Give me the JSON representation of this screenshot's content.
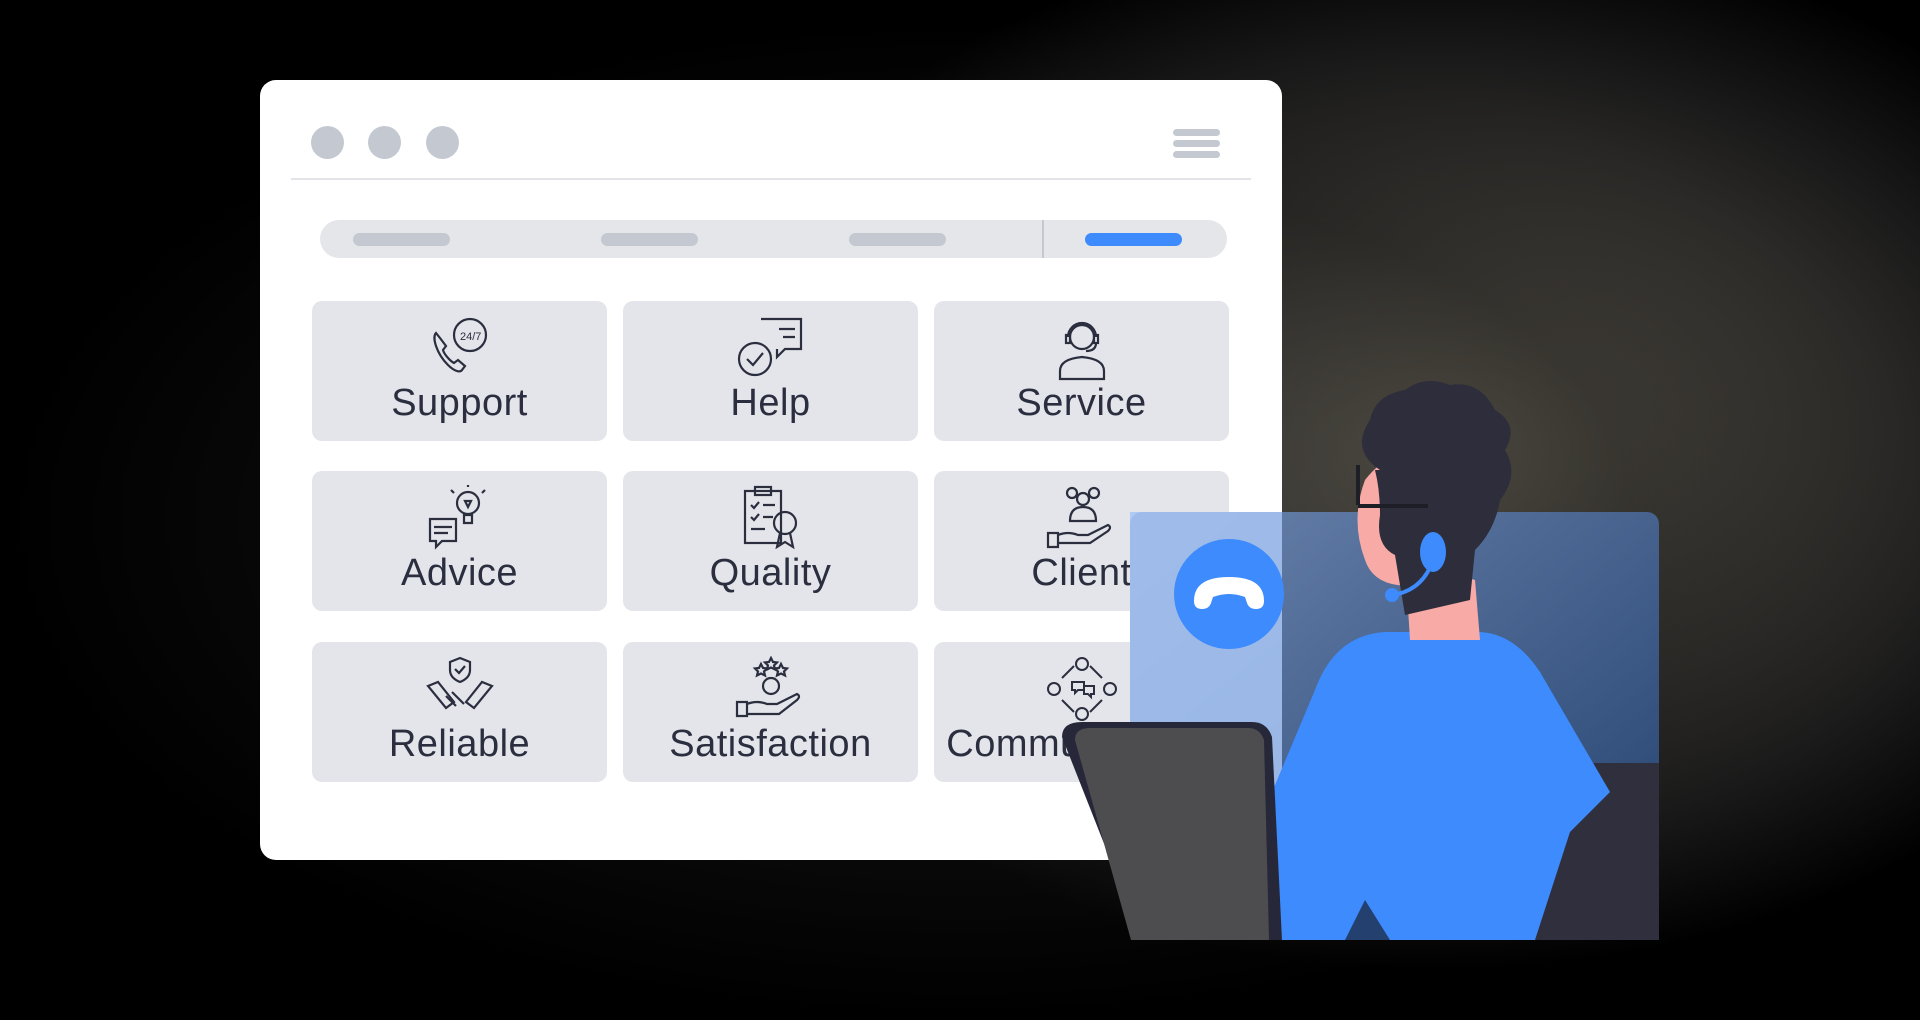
{
  "window": {
    "controls": [
      "close",
      "minimize",
      "maximize"
    ],
    "menu_icon": "hamburger-menu-icon",
    "nav_tabs": [
      {
        "active": false
      },
      {
        "active": false
      },
      {
        "active": false
      },
      {
        "active": true
      }
    ]
  },
  "tiles": [
    {
      "label": "Support",
      "icon": "phone-24-7-icon"
    },
    {
      "label": "Help",
      "icon": "chat-check-icon"
    },
    {
      "label": "Service",
      "icon": "headset-agent-icon"
    },
    {
      "label": "Advice",
      "icon": "lightbulb-chat-icon"
    },
    {
      "label": "Quality",
      "icon": "checklist-badge-icon"
    },
    {
      "label": "Client",
      "icon": "hand-group-icon"
    },
    {
      "label": "Reliable",
      "icon": "handshake-shield-icon"
    },
    {
      "label": "Satisfaction",
      "icon": "hand-stars-icon"
    },
    {
      "label": "Communication",
      "icon": "people-cycle-chat-icon"
    }
  ],
  "call": {
    "icon": "hang-up-phone-icon"
  },
  "colors": {
    "accent": "#3d8bfd",
    "tile_bg": "#e3e5ea",
    "text": "#2b2e3f",
    "panel": "#3f5f8f"
  }
}
